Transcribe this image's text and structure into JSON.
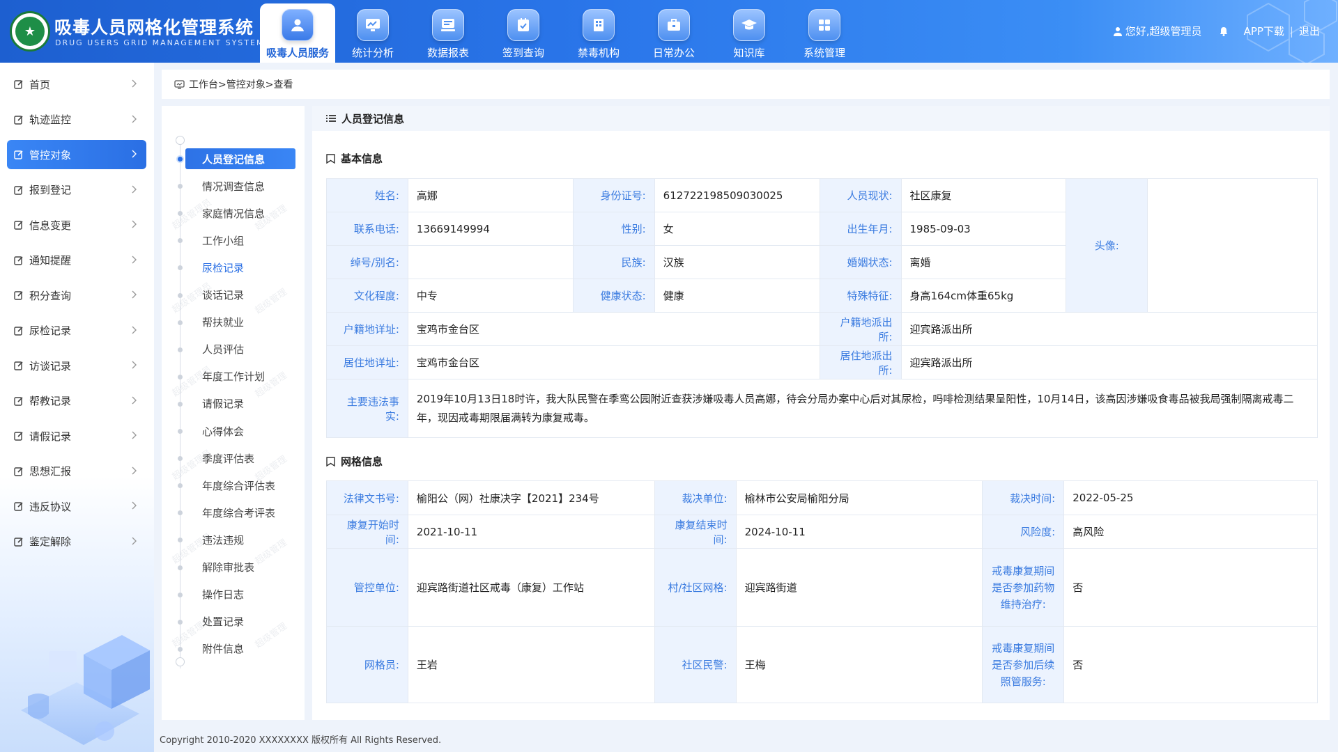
{
  "header": {
    "title": "吸毒人员网格化管理系统",
    "subtitle": "DRUG USERS GRID MANAGEMENT SYSTEM",
    "nav": [
      {
        "label": "吸毒人员服务",
        "icon": "user-icon",
        "active": true
      },
      {
        "label": "统计分析",
        "icon": "chart-monitor-icon"
      },
      {
        "label": "数据报表",
        "icon": "report-icon"
      },
      {
        "label": "签到查询",
        "icon": "checkin-icon"
      },
      {
        "label": "禁毒机构",
        "icon": "building-icon"
      },
      {
        "label": "日常办公",
        "icon": "briefcase-icon"
      },
      {
        "label": "知识库",
        "icon": "graduation-cap-icon"
      },
      {
        "label": "系统管理",
        "icon": "grid-icon"
      }
    ],
    "user": "您好,超级管理员",
    "app_download": "APP下载",
    "separator": "|",
    "logout": "退出"
  },
  "sidebar": {
    "items": [
      {
        "label": "首页"
      },
      {
        "label": "轨迹监控"
      },
      {
        "label": "管控对象",
        "active": true
      },
      {
        "label": "报到登记"
      },
      {
        "label": "信息变更"
      },
      {
        "label": "通知提醒"
      },
      {
        "label": "积分查询"
      },
      {
        "label": "尿检记录"
      },
      {
        "label": "访谈记录"
      },
      {
        "label": "帮教记录"
      },
      {
        "label": "请假记录"
      },
      {
        "label": "思想汇报"
      },
      {
        "label": "违反协议"
      },
      {
        "label": "鉴定解除"
      }
    ]
  },
  "breadcrumb": "工作台>管控对象>查看",
  "subnav": {
    "items": [
      {
        "label": "人员登记信息",
        "state": "active"
      },
      {
        "label": "情况调查信息"
      },
      {
        "label": "家庭情况信息"
      },
      {
        "label": "工作小组"
      },
      {
        "label": "尿检记录",
        "state": "blue"
      },
      {
        "label": "谈话记录"
      },
      {
        "label": "帮扶就业"
      },
      {
        "label": "人员评估"
      },
      {
        "label": "年度工作计划"
      },
      {
        "label": "请假记录"
      },
      {
        "label": "心得体会"
      },
      {
        "label": "季度评估表"
      },
      {
        "label": "年度综合评估表"
      },
      {
        "label": "年度综合考评表"
      },
      {
        "label": "违法违规"
      },
      {
        "label": "解除审批表"
      },
      {
        "label": "操作日志"
      },
      {
        "label": "处置记录"
      },
      {
        "label": "附件信息"
      }
    ],
    "watermark_a": "超级管理",
    "watermark_b": "超级管理员"
  },
  "main": {
    "title": "人员登记信息",
    "basic": {
      "title": "基本信息",
      "name_label": "姓名:",
      "name": "高娜",
      "id_label": "身份证号:",
      "id": "612722198509030025",
      "status_label": "人员现状:",
      "status": "社区康复",
      "avatar_label": "头像:",
      "phone_label": "联系电话:",
      "phone": "13669149994",
      "gender_label": "性别:",
      "gender": "女",
      "birth_label": "出生年月:",
      "birth": "1985-09-03",
      "alias_label": "绰号/别名:",
      "alias": "",
      "ethnic_label": "民族:",
      "ethnic": "汉族",
      "marital_label": "婚姻状态:",
      "marital": "离婚",
      "edu_label": "文化程度:",
      "edu": "中专",
      "health_label": "健康状态:",
      "health": "健康",
      "feature_label": "特殊特征:",
      "feature": "身高164cm体重65kg",
      "hukou_addr_label": "户籍地详址:",
      "hukou_addr": "宝鸡市金台区",
      "hukou_police_label": "户籍地派出所:",
      "hukou_police": "迎宾路派出所",
      "live_addr_label": "居住地详址:",
      "live_addr": "宝鸡市金台区",
      "live_police_label": "居住地派出所:",
      "live_police": "迎宾路派出所",
      "facts_label": "主要违法事实:",
      "facts": "2019年10月13日18时许，我大队民警在季鸾公园附近查获涉嫌吸毒人员高娜，待会分局办案中心后对其尿检，吗啡检测结果呈阳性，10月14日，该高因涉嫌吸食毒品被我局强制隔离戒毒二年，现因戒毒期限届满转为康复戒毒。"
    },
    "grid": {
      "title": "网格信息",
      "doc_label": "法律文书号:",
      "doc": "榆阳公（网）社康决字【2021】234号",
      "unit_label": "裁决单位:",
      "unit": "榆林市公安局榆阳分局",
      "time_label": "裁决时间:",
      "time": "2022-05-25",
      "start_label": "康复开始时间:",
      "start": "2021-10-11",
      "end_label": "康复结束时间:",
      "end": "2024-10-11",
      "risk_label": "风险度:",
      "risk": "高风险",
      "control_label": "管控单位:",
      "control": "迎宾路街道社区戒毒（康复）工作站",
      "community_label": "村/社区网格:",
      "community": "迎宾路街道",
      "drug_treat_label": "戒毒康复期间是否参加药物维持治疗:",
      "drug_treat": "否",
      "grid_member_label": "网格员:",
      "grid_member": "王岩",
      "police_label": "社区民警:",
      "police": "王梅",
      "aftercare_label": "戒毒康复期间是否参加后续照管服务:",
      "aftercare": "否"
    }
  },
  "footer": "Copyright 2010-2020 XXXXXXXX 版权所有 All Rights Reserved.",
  "colors": {
    "primary": "#2a6fe4",
    "label_bg": "#ecf3fe",
    "label_text": "#3a7be0"
  }
}
